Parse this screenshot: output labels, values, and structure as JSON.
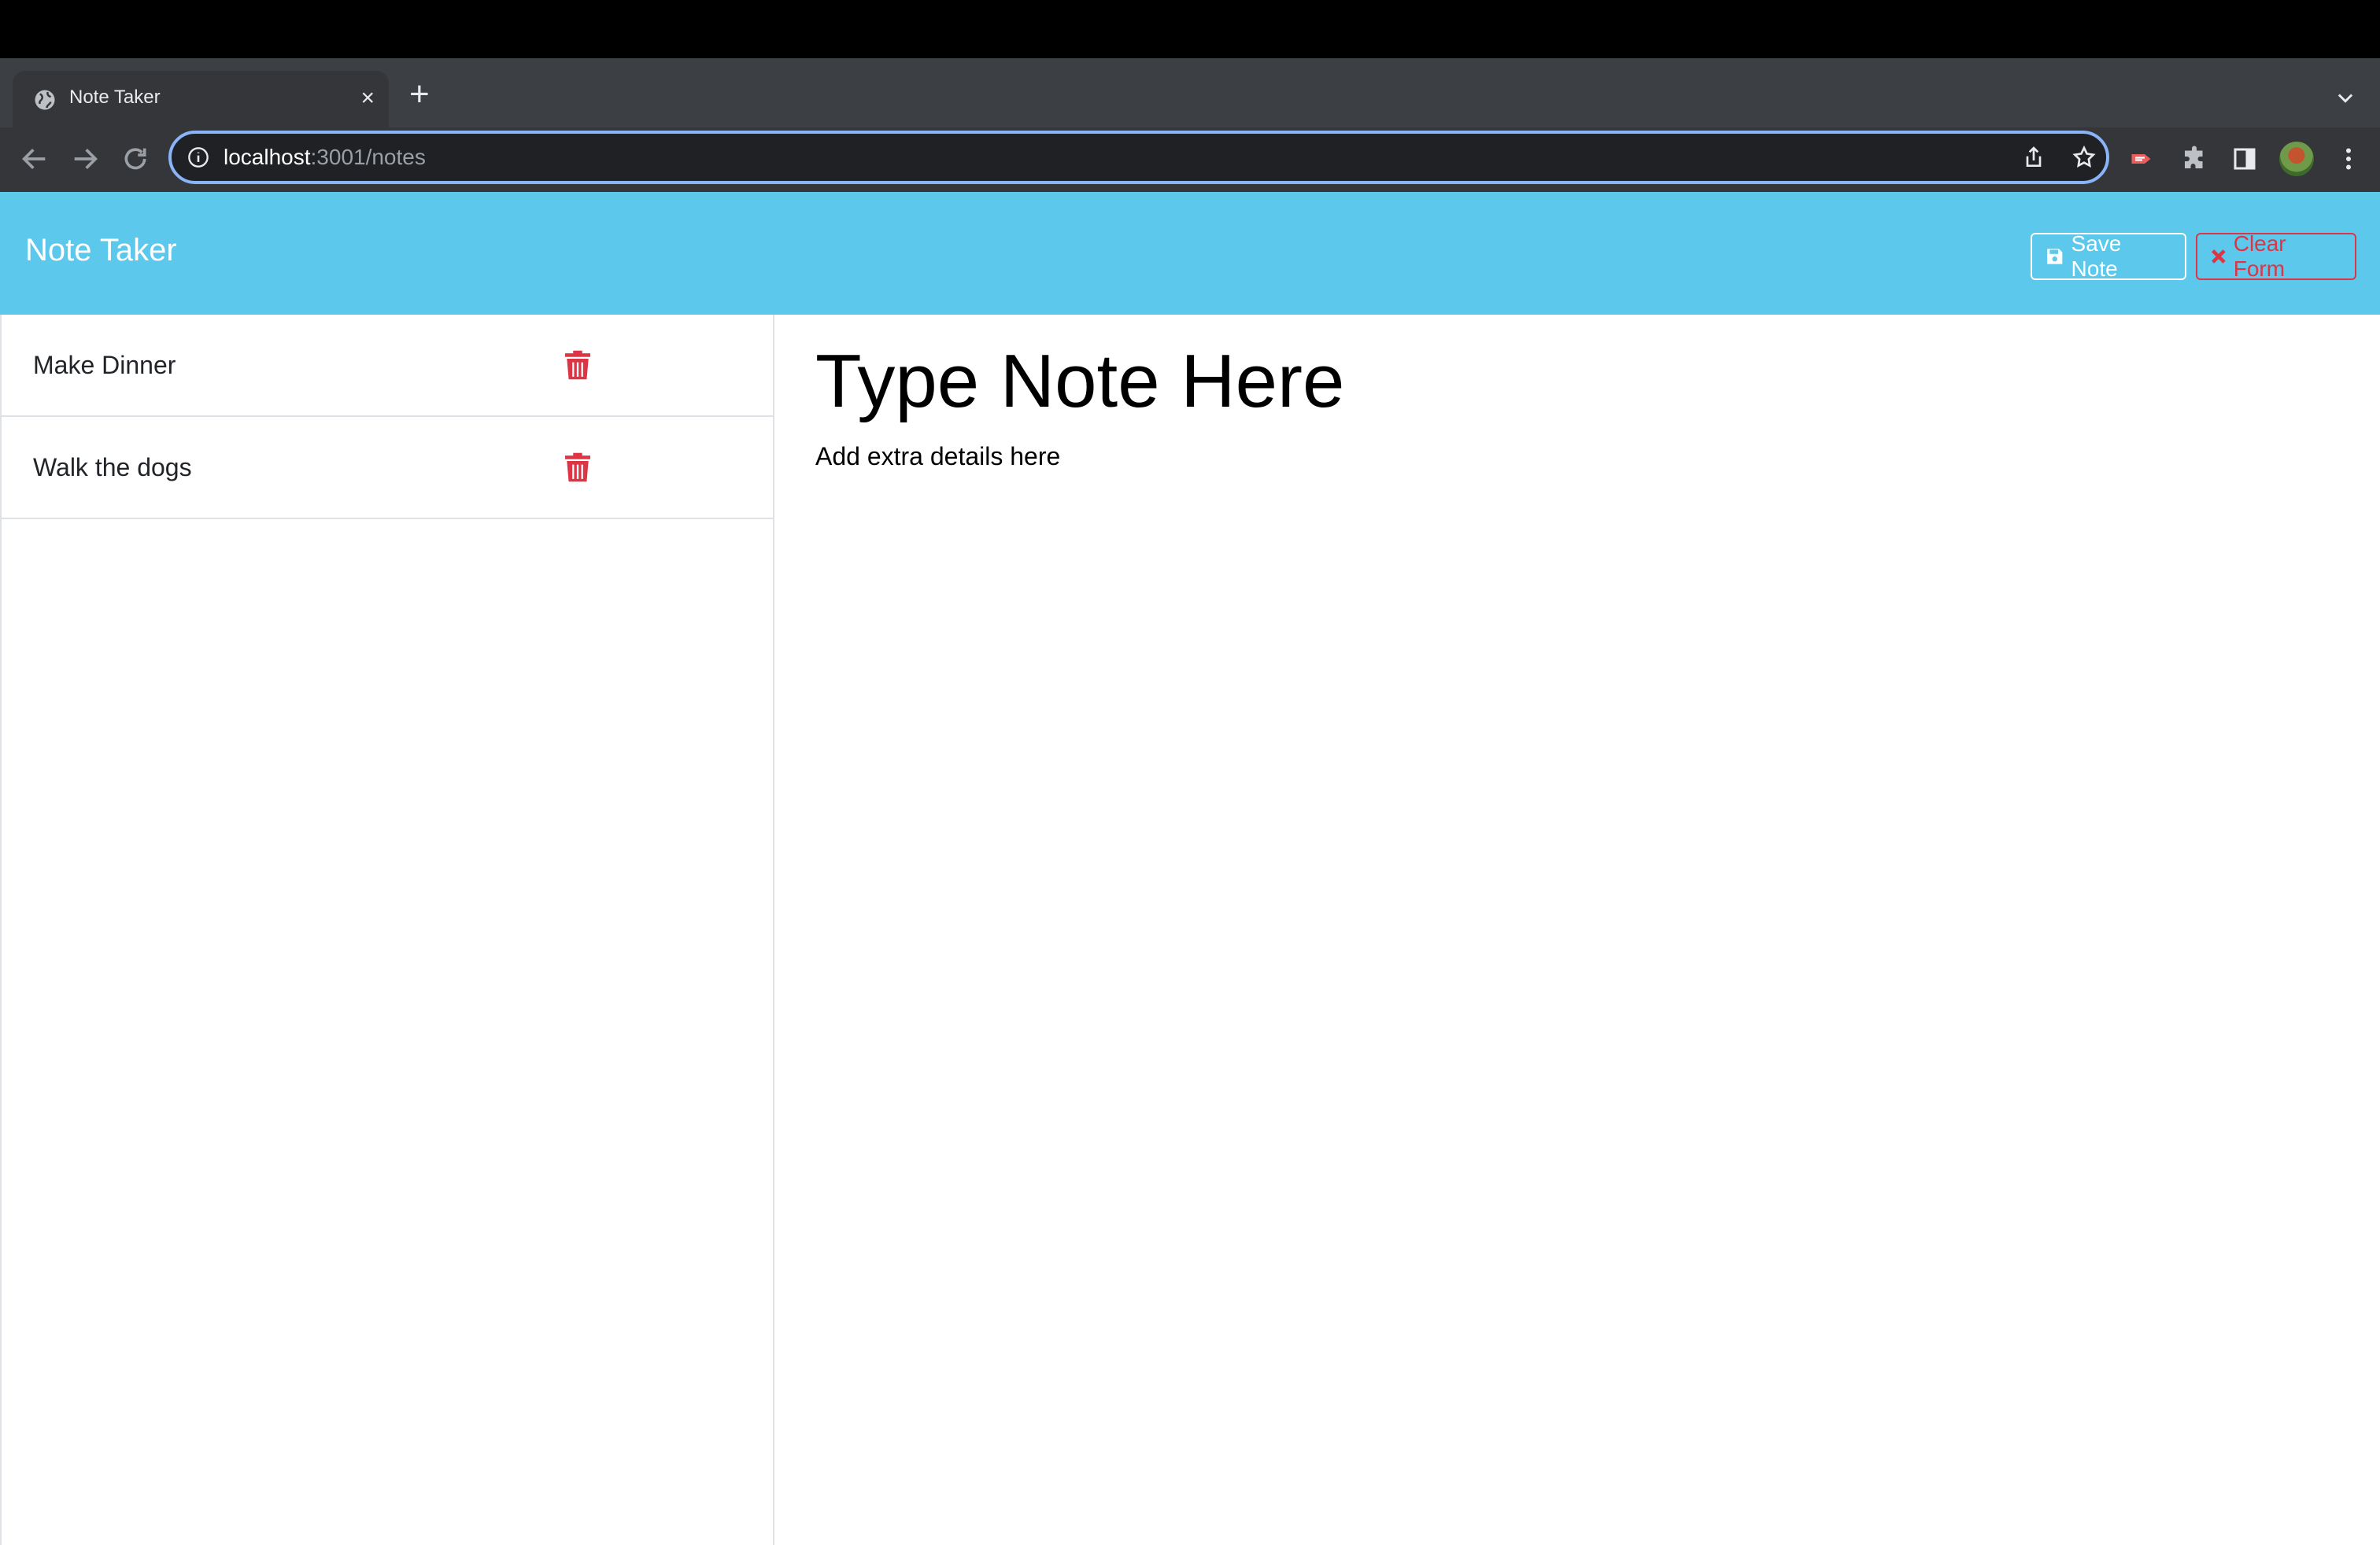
{
  "browser": {
    "tab": {
      "title": "Note Taker",
      "close": "×"
    },
    "new_tab": "+",
    "address": {
      "host": "localhost",
      "path": ":3001/notes"
    }
  },
  "app": {
    "brand": "Note Taker",
    "save_label": "Save Note",
    "clear_label": "Clear Form"
  },
  "notes": [
    {
      "title": "Make Dinner"
    },
    {
      "title": "Walk the dogs"
    }
  ],
  "editor": {
    "title_placeholder": "Type Note Here",
    "body_placeholder": "Add extra details here"
  },
  "colors": {
    "header": "#5bc8ec",
    "danger": "#dc3545",
    "omnibox_focus": "#8ab4f8"
  }
}
